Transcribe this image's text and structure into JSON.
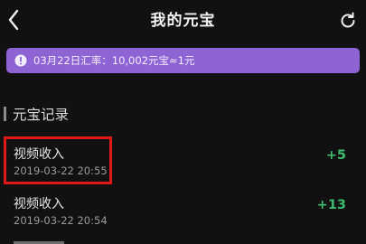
{
  "header": {
    "title": "我的元宝",
    "back_icon": "chevron-left-icon",
    "refresh_icon": "refresh-icon"
  },
  "notice": {
    "icon": "info-icon",
    "text": "03月22日汇率：10,002元宝≈1元",
    "background_color": "#8e63d4"
  },
  "section": {
    "title": "元宝记录"
  },
  "records": [
    {
      "title": "视频收入",
      "time": "2019-03-22 20:55",
      "amount": "+5"
    },
    {
      "title": "视频收入",
      "time": "2019-03-22 20:54",
      "amount": "+13"
    }
  ],
  "colors": {
    "background": "#111111",
    "amount_positive": "#3dbb6e",
    "highlight": "#e01818"
  }
}
